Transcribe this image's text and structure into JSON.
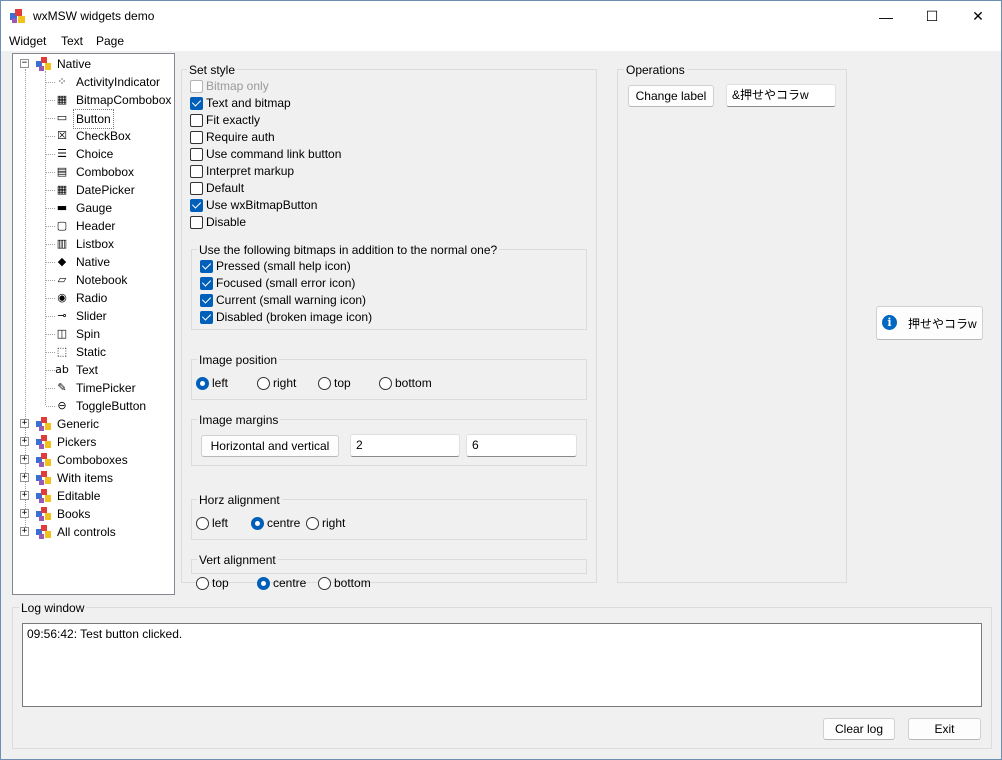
{
  "window": {
    "title": "wxMSW widgets demo",
    "minimize_glyph": "—",
    "maximize_glyph": "☐",
    "close_glyph": "✕"
  },
  "menu": [
    "Widget",
    "Text",
    "Page"
  ],
  "tree": {
    "root": "Native",
    "leaves": [
      {
        "label": "ActivityIndicator",
        "icon": "activity-indicator-icon",
        "glyph": "⁘"
      },
      {
        "label": "BitmapCombobox",
        "icon": "bitmap-combobox-icon",
        "glyph": "▦"
      },
      {
        "label": "Button",
        "icon": "button-icon",
        "glyph": "▭"
      },
      {
        "label": "CheckBox",
        "icon": "checkbox-icon",
        "glyph": "☒"
      },
      {
        "label": "Choice",
        "icon": "choice-icon",
        "glyph": "☰"
      },
      {
        "label": "Combobox",
        "icon": "combobox-icon",
        "glyph": "▤"
      },
      {
        "label": "DatePicker",
        "icon": "date-picker-icon",
        "glyph": "▦"
      },
      {
        "label": "Gauge",
        "icon": "gauge-icon",
        "glyph": "▬"
      },
      {
        "label": "Header",
        "icon": "header-icon",
        "glyph": "▢"
      },
      {
        "label": "Listbox",
        "icon": "listbox-icon",
        "glyph": "▥"
      },
      {
        "label": "Native",
        "icon": "native-icon",
        "glyph": "◆"
      },
      {
        "label": "Notebook",
        "icon": "notebook-icon",
        "glyph": "▱"
      },
      {
        "label": "Radio",
        "icon": "radio-icon",
        "glyph": "◉"
      },
      {
        "label": "Slider",
        "icon": "slider-icon",
        "glyph": "⊸"
      },
      {
        "label": "Spin",
        "icon": "spin-icon",
        "glyph": "◫"
      },
      {
        "label": "Static",
        "icon": "static-icon",
        "glyph": "⬚"
      },
      {
        "label": "Text",
        "icon": "text-icon",
        "glyph": "ab"
      },
      {
        "label": "TimePicker",
        "icon": "time-picker-icon",
        "glyph": "✎"
      },
      {
        "label": "ToggleButton",
        "icon": "toggle-button-icon",
        "glyph": "⊖"
      }
    ],
    "categories": [
      "Generic",
      "Pickers",
      "Comboboxes",
      "With items",
      "Editable",
      "Books",
      "All controls"
    ],
    "selected": "Button"
  },
  "set_style": {
    "label": "Set style",
    "options": [
      {
        "label": "Bitmap only",
        "checked": false,
        "disabled": true
      },
      {
        "label": "Text and bitmap",
        "checked": true,
        "disabled": false
      },
      {
        "label": "Fit exactly",
        "checked": false,
        "disabled": false
      },
      {
        "label": "Require auth",
        "checked": false,
        "disabled": false
      },
      {
        "label": "Use command link button",
        "checked": false,
        "disabled": false
      },
      {
        "label": "Interpret markup",
        "checked": false,
        "disabled": false
      },
      {
        "label": "Default",
        "checked": false,
        "disabled": false
      },
      {
        "label": "Use wxBitmapButton",
        "checked": true,
        "disabled": false
      },
      {
        "label": "Disable",
        "checked": false,
        "disabled": false
      }
    ]
  },
  "bitmaps": {
    "label": "Use the following bitmaps in addition to the normal one?",
    "options": [
      {
        "label": "Pressed (small help icon)",
        "checked": true
      },
      {
        "label": "Focused (small error icon)",
        "checked": true
      },
      {
        "label": "Current (small warning icon)",
        "checked": true
      },
      {
        "label": "Disabled (broken image icon)",
        "checked": true
      }
    ]
  },
  "image_position": {
    "label": "Image position",
    "options": [
      "left",
      "right",
      "top",
      "bottom"
    ],
    "selected": "left"
  },
  "image_margins": {
    "label": "Image margins",
    "button": "Horizontal and vertical",
    "horizontal": "2",
    "vertical": "6"
  },
  "horz_alignment": {
    "label": "Horz alignment",
    "options": [
      "left",
      "centre",
      "right"
    ],
    "selected": "centre"
  },
  "vert_alignment": {
    "label": "Vert alignment",
    "options": [
      "top",
      "centre",
      "bottom"
    ],
    "selected": "centre"
  },
  "operations": {
    "label": "Operations",
    "change_label_button": "Change label",
    "label_value": "&押せやコラw"
  },
  "test_button": {
    "label": "押せやコラw",
    "icon": "info-icon",
    "glyph": "i"
  },
  "log": {
    "label": "Log window",
    "lines": [
      "09:56:42: Test button clicked."
    ],
    "clear_button": "Clear log",
    "exit_button": "Exit"
  },
  "colors": {
    "accent": "#005fb8",
    "info": "#0067c0"
  }
}
